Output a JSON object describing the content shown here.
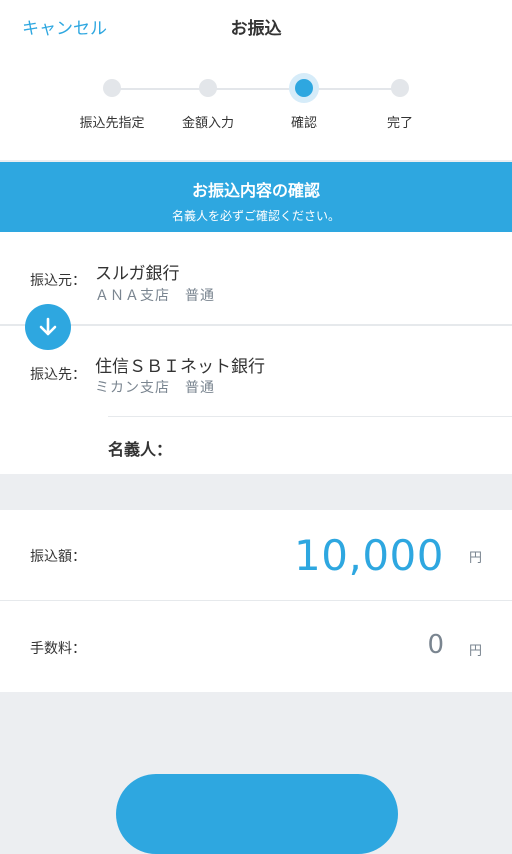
{
  "header": {
    "cancel_label": "キャンセル",
    "title": "お振込"
  },
  "steps": [
    {
      "label": "振込先指定",
      "state": "done"
    },
    {
      "label": "金額入力",
      "state": "done"
    },
    {
      "label": "確認",
      "state": "active"
    },
    {
      "label": "完了",
      "state": "pending"
    }
  ],
  "banner": {
    "title": "お振込内容の確認",
    "subtitle": "名義人を必ずご確認ください。"
  },
  "source": {
    "label": "振込元：",
    "bank": "スルガ銀行",
    "branch": "ＡＮＡ支店　普通"
  },
  "destination": {
    "label": "振込先：",
    "bank": "住信ＳＢＩネット銀行",
    "branch": "ミカン支店　普通",
    "holder_label": "名義人："
  },
  "amount": {
    "label": "振込額：",
    "value": "10,000",
    "unit": "円"
  },
  "fee": {
    "label": "手数料：",
    "value": "0",
    "unit": "円"
  },
  "colors": {
    "accent": "#2ea7e0",
    "background": "#eceef1",
    "muted_text": "#7a8590"
  }
}
